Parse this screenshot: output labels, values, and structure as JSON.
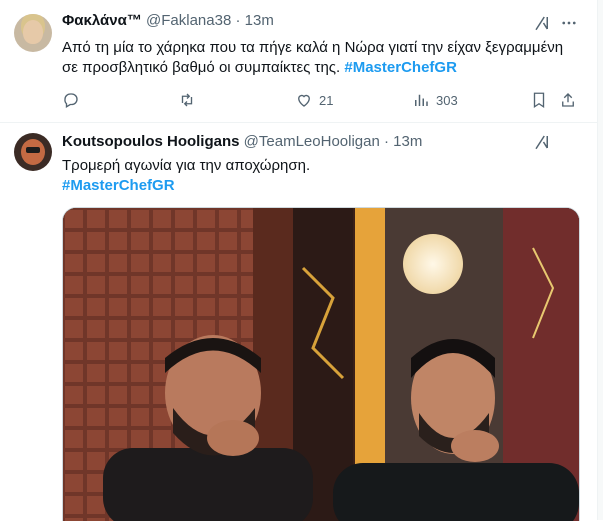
{
  "tweets": [
    {
      "name": "Φακλάνα™",
      "handle": "@Faklana38",
      "dot": "·",
      "time": "13m",
      "text_line1": "Από τη μία το χάρηκα που τα πήγε καλά η Νώρα γιατί την είχαν ξεγραμμένη",
      "text_line2": "σε προσβλητικό βαθμό οι συμπαίκτες της. ",
      "hashtag": "#MasterChefGR",
      "likes": "21",
      "views": "303"
    },
    {
      "name": "Koutsopoulos Hooligans",
      "handle": "@TeamLeoHooligan",
      "dot": "·",
      "time": "13m",
      "text_line1": "Τρομερή αγωνία για την αποχώρηση.",
      "hashtag": "#MasterChefGR"
    }
  ],
  "icons": [
    "grok-icon",
    "more-icon",
    "reply-icon",
    "retweet-icon",
    "like-icon",
    "views-icon",
    "bookmark-icon",
    "share-icon"
  ],
  "colors": {
    "accent": "#1d9bf0",
    "muted": "#536471",
    "text": "#0f1419"
  }
}
